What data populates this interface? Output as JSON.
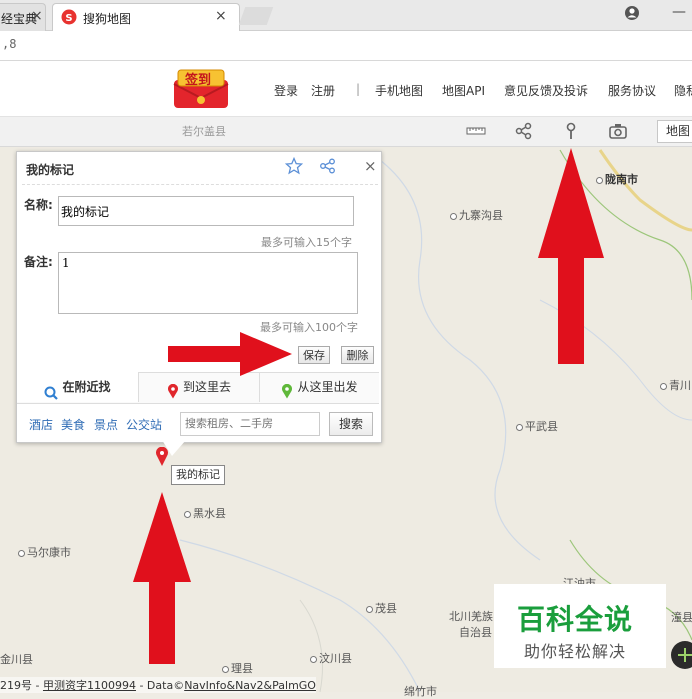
{
  "browser": {
    "tab1_label": "经宝典",
    "tab2_label": "搜狗地图",
    "url": ",8",
    "account_icon": "user-icon",
    "minimize_label": "—"
  },
  "header": {
    "signin_badge": "签到",
    "links": [
      "登录",
      "注册",
      "|",
      "手机地图",
      "地图API",
      "意见反馈及投诉",
      "服务协议",
      "隐私"
    ]
  },
  "toolbar": {
    "icons": [
      "ruler-icon",
      "share-icon",
      "pin-icon",
      "camera-icon"
    ],
    "map_type": "地图"
  },
  "popup": {
    "title": "我的标记",
    "name_label": "名称:",
    "name_value": "我的标记",
    "name_hint": "最多可输入15个字",
    "note_label": "备注:",
    "note_value": "1",
    "note_hint": "最多可输入100个字",
    "save": "保存",
    "delete": "删除",
    "tabs": [
      "在附近找",
      "到这里去",
      "从这里出发"
    ],
    "categories": [
      "酒店",
      "美食",
      "景点",
      "公交站"
    ],
    "search_placeholder": "搜索租房、二手房",
    "search_button": "搜索",
    "close": "×"
  },
  "marker_label": "我的标记",
  "map": {
    "places": {
      "longnan": "陇南市",
      "jiuzhaigou": "九寨沟县",
      "pingwu": "平武县",
      "qingchuan": "青川",
      "heishui": "黑水县",
      "maerkang": "马尔康市",
      "maoxian": "茂县",
      "beichuan1": "北川羌族",
      "beichuan2": "自治县",
      "jiangyou": "江油市",
      "lixian": "理县",
      "wenchuan": "汶川县",
      "jinchuan": "金川县",
      "ruoergai": "若尔盖县",
      "mianzhu": "绵竹市",
      "zitong": "潼县"
    }
  },
  "watermark": {
    "main": "百科全说",
    "sub": "助你轻松解决"
  },
  "footer": {
    "prefix": "219号 - ",
    "link1": "甲测资字1100994",
    "mid": " - Data©",
    "link2": "NavInfo&Nav2&PalmGO"
  },
  "colors": {
    "arrow": "#e0101c",
    "brand_green": "#1a9e3c",
    "link_blue": "#2f6cb5"
  }
}
